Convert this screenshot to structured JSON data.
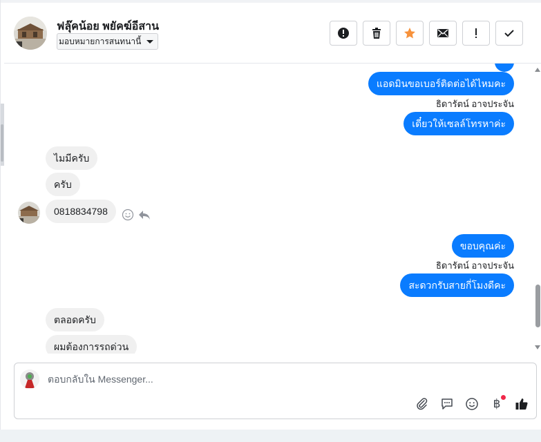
{
  "header": {
    "contact_name": "ฟลุ๊คน้อย พยัคฆ์อีสาน",
    "assign_label": "มอบหมายการสนทนานี้"
  },
  "messages": [
    {
      "dir": "out",
      "text": "แอดมินขอเบอร์ติดต่อได้ไหมคะ"
    },
    {
      "dir": "sender",
      "text": "ธิดารัตน์ อาจประจัน"
    },
    {
      "dir": "out",
      "text": "เดี๋ยวให้เซลล์โทรหาค่ะ"
    },
    {
      "dir": "in",
      "text": "ไมมีครับ"
    },
    {
      "dir": "in",
      "text": "ครับ"
    },
    {
      "dir": "in",
      "text": "0818834798"
    },
    {
      "dir": "out",
      "text": "ขอบคุณค่ะ"
    },
    {
      "dir": "sender",
      "text": "ธิดารัตน์ อาจประจัน"
    },
    {
      "dir": "out",
      "text": "สะดวกรับสายกี่โมงดีคะ"
    },
    {
      "dir": "in",
      "text": "ตลอดครับ"
    },
    {
      "dir": "in",
      "text": "ผมต้องการรถด่วน"
    }
  ],
  "composer": {
    "placeholder": "ตอบกลับใน Messenger..."
  },
  "colors": {
    "outgoing_bubble": "#0a7cff",
    "incoming_bubble": "#f0f0f0",
    "star": "#f7923b",
    "notification_dot": "#f02849"
  },
  "icons": {
    "header_actions": [
      "alert-icon",
      "trash-icon",
      "star-icon",
      "envelope-icon",
      "exclamation-icon",
      "check-icon"
    ],
    "composer_tools": [
      "paperclip-icon",
      "speech-bubble-icon",
      "smiley-icon",
      "baht-icon",
      "thumbs-up-icon"
    ]
  }
}
